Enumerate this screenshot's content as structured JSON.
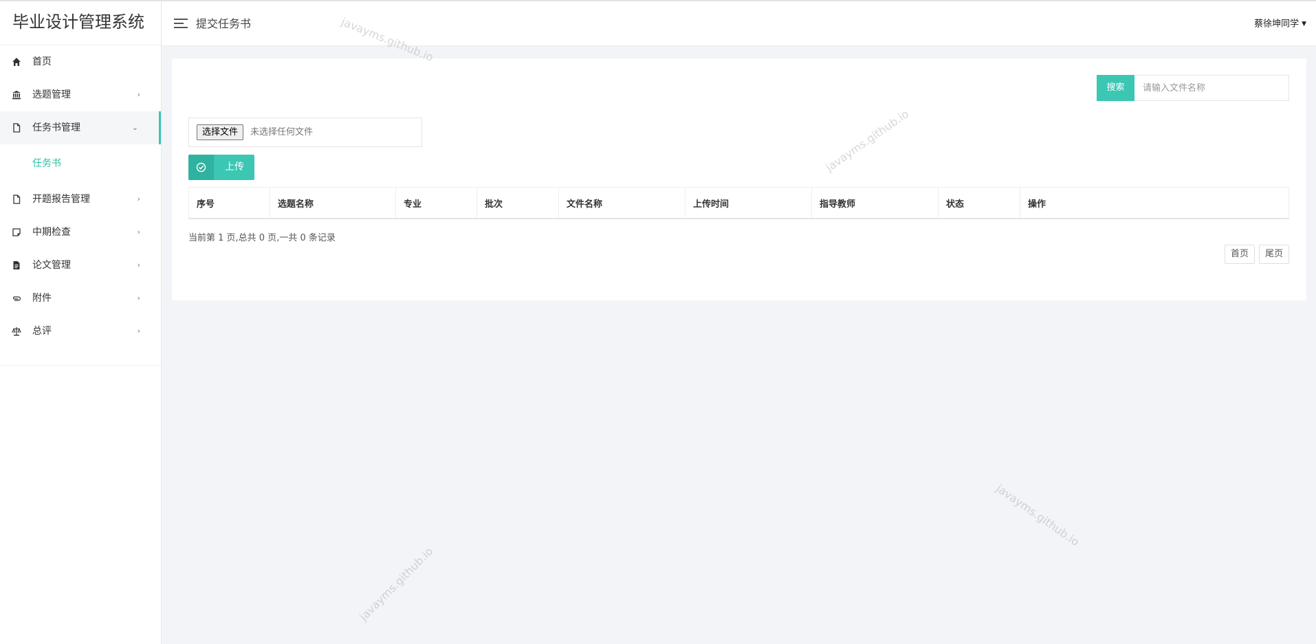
{
  "app": {
    "title": "毕业设计管理系统"
  },
  "header": {
    "page_title": "提交任务书",
    "user_name": "蔡徐坤同学"
  },
  "sidebar": {
    "items": [
      {
        "label": "首页",
        "icon": "home-icon"
      },
      {
        "label": "选题管理",
        "icon": "bank-icon"
      },
      {
        "label": "任务书管理",
        "icon": "file-icon",
        "expanded": true
      },
      {
        "label": "开题报告管理",
        "icon": "file-icon"
      },
      {
        "label": "中期检查",
        "icon": "sticky-note-icon"
      },
      {
        "label": "论文管理",
        "icon": "file-text-icon"
      },
      {
        "label": "附件",
        "icon": "paperclip-icon"
      },
      {
        "label": "总评",
        "icon": "scale-icon"
      }
    ],
    "subitems": [
      {
        "label": "任务书",
        "active": true
      }
    ]
  },
  "search": {
    "button_label": "搜索",
    "placeholder": "请输入文件名称"
  },
  "upload": {
    "choose_label": "选择文件",
    "no_file_text": "未选择任何文件",
    "upload_label": "上传"
  },
  "table": {
    "columns": [
      "序号",
      "选题名称",
      "专业",
      "批次",
      "文件名称",
      "上传时间",
      "指导教师",
      "状态",
      "操作"
    ],
    "rows": []
  },
  "pagination": {
    "info": "当前第 1 页,总共 0 页,一共 0 条记录",
    "first_label": "首页",
    "last_label": "尾页"
  },
  "watermark": {
    "text": "javayms.github.io"
  },
  "colors": {
    "accent": "#3cc6b4",
    "accent_dark": "#2fb29f",
    "background": "#f3f4f7"
  }
}
